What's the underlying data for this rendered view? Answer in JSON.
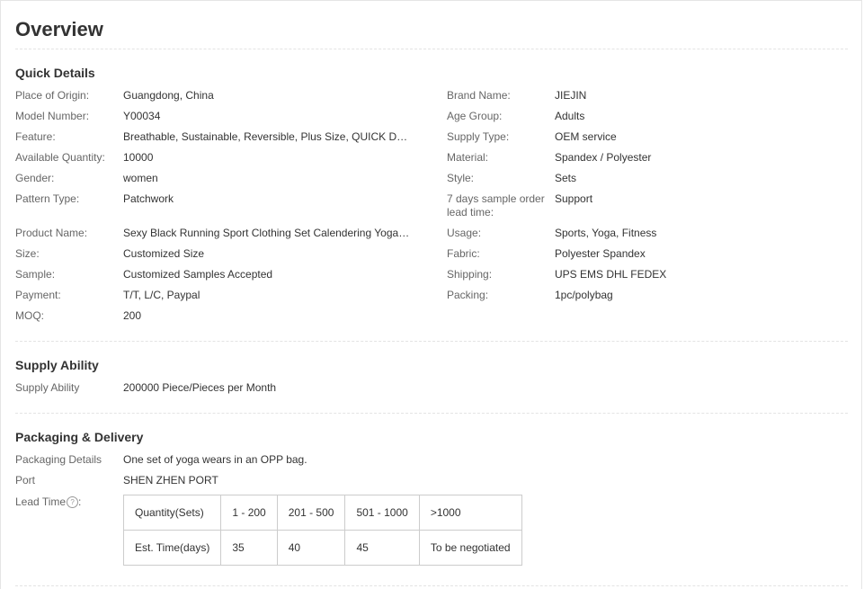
{
  "page": {
    "title": "Overview"
  },
  "quick_details": {
    "title": "Quick Details",
    "left": [
      {
        "label": "Place of Origin:",
        "value": "Guangdong, China"
      },
      {
        "label": "Model Number:",
        "value": "Y00034"
      },
      {
        "label": "Feature:",
        "value": "Breathable, Sustainable, Reversible, Plus Size, QUICK DRY, W..."
      },
      {
        "label": "Available Quantity:",
        "value": "10000"
      },
      {
        "label": "Gender:",
        "value": "women"
      },
      {
        "label": "Pattern Type:",
        "value": "Patchwork"
      },
      {
        "label": "Product Name:",
        "value": "Sexy Black Running Sport Clothing Set Calendering Yoga Pa..."
      },
      {
        "label": "Size:",
        "value": "Customized Size"
      },
      {
        "label": "Sample:",
        "value": "Customized Samples Accepted"
      },
      {
        "label": "Payment:",
        "value": "T/T, L/C, Paypal"
      },
      {
        "label": "MOQ:",
        "value": "200"
      }
    ],
    "right": [
      {
        "label": "Brand Name:",
        "value": "JIEJIN"
      },
      {
        "label": "Age Group:",
        "value": "Adults"
      },
      {
        "label": "Supply Type:",
        "value": "OEM service"
      },
      {
        "label": "Material:",
        "value": "Spandex / Polyester"
      },
      {
        "label": "Style:",
        "value": "Sets"
      },
      {
        "label": "7 days sample order lead time:",
        "value": "Support"
      },
      {
        "label": "Usage:",
        "value": "Sports, Yoga, Fitness"
      },
      {
        "label": "Fabric:",
        "value": "Polyester Spandex"
      },
      {
        "label": "Shipping:",
        "value": "UPS EMS DHL FEDEX"
      },
      {
        "label": "Packing:",
        "value": "1pc/polybag"
      }
    ]
  },
  "supply_ability": {
    "title": "Supply Ability",
    "label": "Supply Ability",
    "value": "200000 Piece/Pieces per Month"
  },
  "packaging": {
    "title": "Packaging & Delivery",
    "details_label": "Packaging Details",
    "details_value": "One set of yoga wears in an OPP bag.",
    "port_label": "Port",
    "port_value": "SHEN ZHEN PORT",
    "lead_time_label": "Lead Time",
    "lead_time_suffix": ":",
    "help_glyph": "?",
    "icon": "help-circle-icon",
    "table": {
      "header": [
        "Quantity(Sets)",
        "1 - 200",
        "201 - 500",
        "501 - 1000",
        ">1000"
      ],
      "row": [
        "Est. Time(days)",
        "35",
        "40",
        "45",
        "To be negotiated"
      ]
    }
  }
}
